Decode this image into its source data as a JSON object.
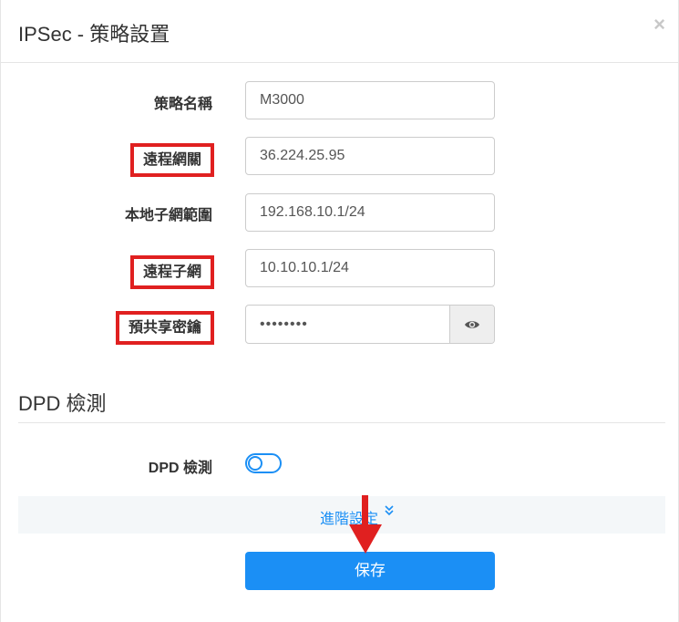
{
  "dialog": {
    "title": "IPSec - 策略設置",
    "close_glyph": "×"
  },
  "form": {
    "policy_name": {
      "label": "策略名稱",
      "value": "M3000"
    },
    "remote_gateway": {
      "label": "遠程網關",
      "value": "36.224.25.95",
      "highlighted": true
    },
    "local_subnet": {
      "label": "本地子網範圍",
      "value": "192.168.10.1/24"
    },
    "remote_subnet": {
      "label": "遠程子網",
      "value": "10.10.10.1/24",
      "highlighted": true
    },
    "preshared_key": {
      "label": "預共享密鑰",
      "value": "••••••••",
      "highlighted": true,
      "icon": "eye-icon"
    }
  },
  "dpd": {
    "section_title": "DPD 檢測",
    "label": "DPD 檢測",
    "enabled": false
  },
  "advanced": {
    "label": "進階設定",
    "icon": "double-chevron-down-icon"
  },
  "actions": {
    "save_label": "保存"
  },
  "colors": {
    "accent": "#1b8ff5",
    "highlight": "#e02020",
    "addon_bg": "#eeeeee",
    "advanced_bg": "#f4f7f9"
  }
}
